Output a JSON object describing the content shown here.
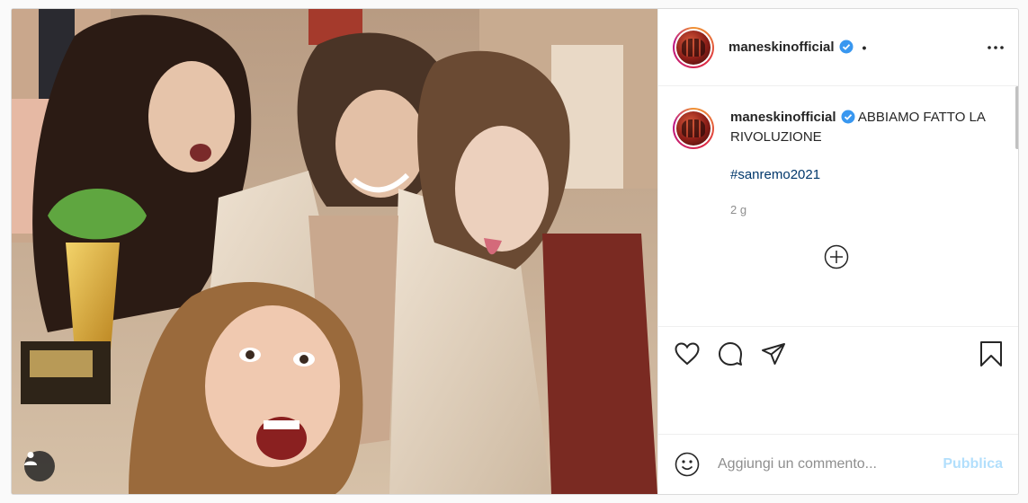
{
  "post": {
    "image_alt": "Photo by maneskinofficial",
    "user_tag_icon": "user-tag-icon"
  },
  "header": {
    "username": "maneskinofficial",
    "separator": "•",
    "more_icon": "more-options-icon"
  },
  "caption": {
    "username": "maneskinofficial",
    "text": "ABBIAMO FATTO LA RIVOLUZIONE",
    "hashtag": "#sanremo2021",
    "timestamp": "2 g"
  },
  "actions": {
    "like_icon": "heart-icon",
    "comment_icon": "comment-icon",
    "share_icon": "share-icon",
    "save_icon": "bookmark-icon"
  },
  "comment_box": {
    "emoji_icon": "emoji-icon",
    "placeholder": "Aggiungi un commento...",
    "publish_label": "Pubblica"
  },
  "colors": {
    "verified": "#3897f0",
    "hashtag": "#00376b",
    "publish_disabled": "#b2dffc",
    "muted": "#8e8e8e"
  }
}
